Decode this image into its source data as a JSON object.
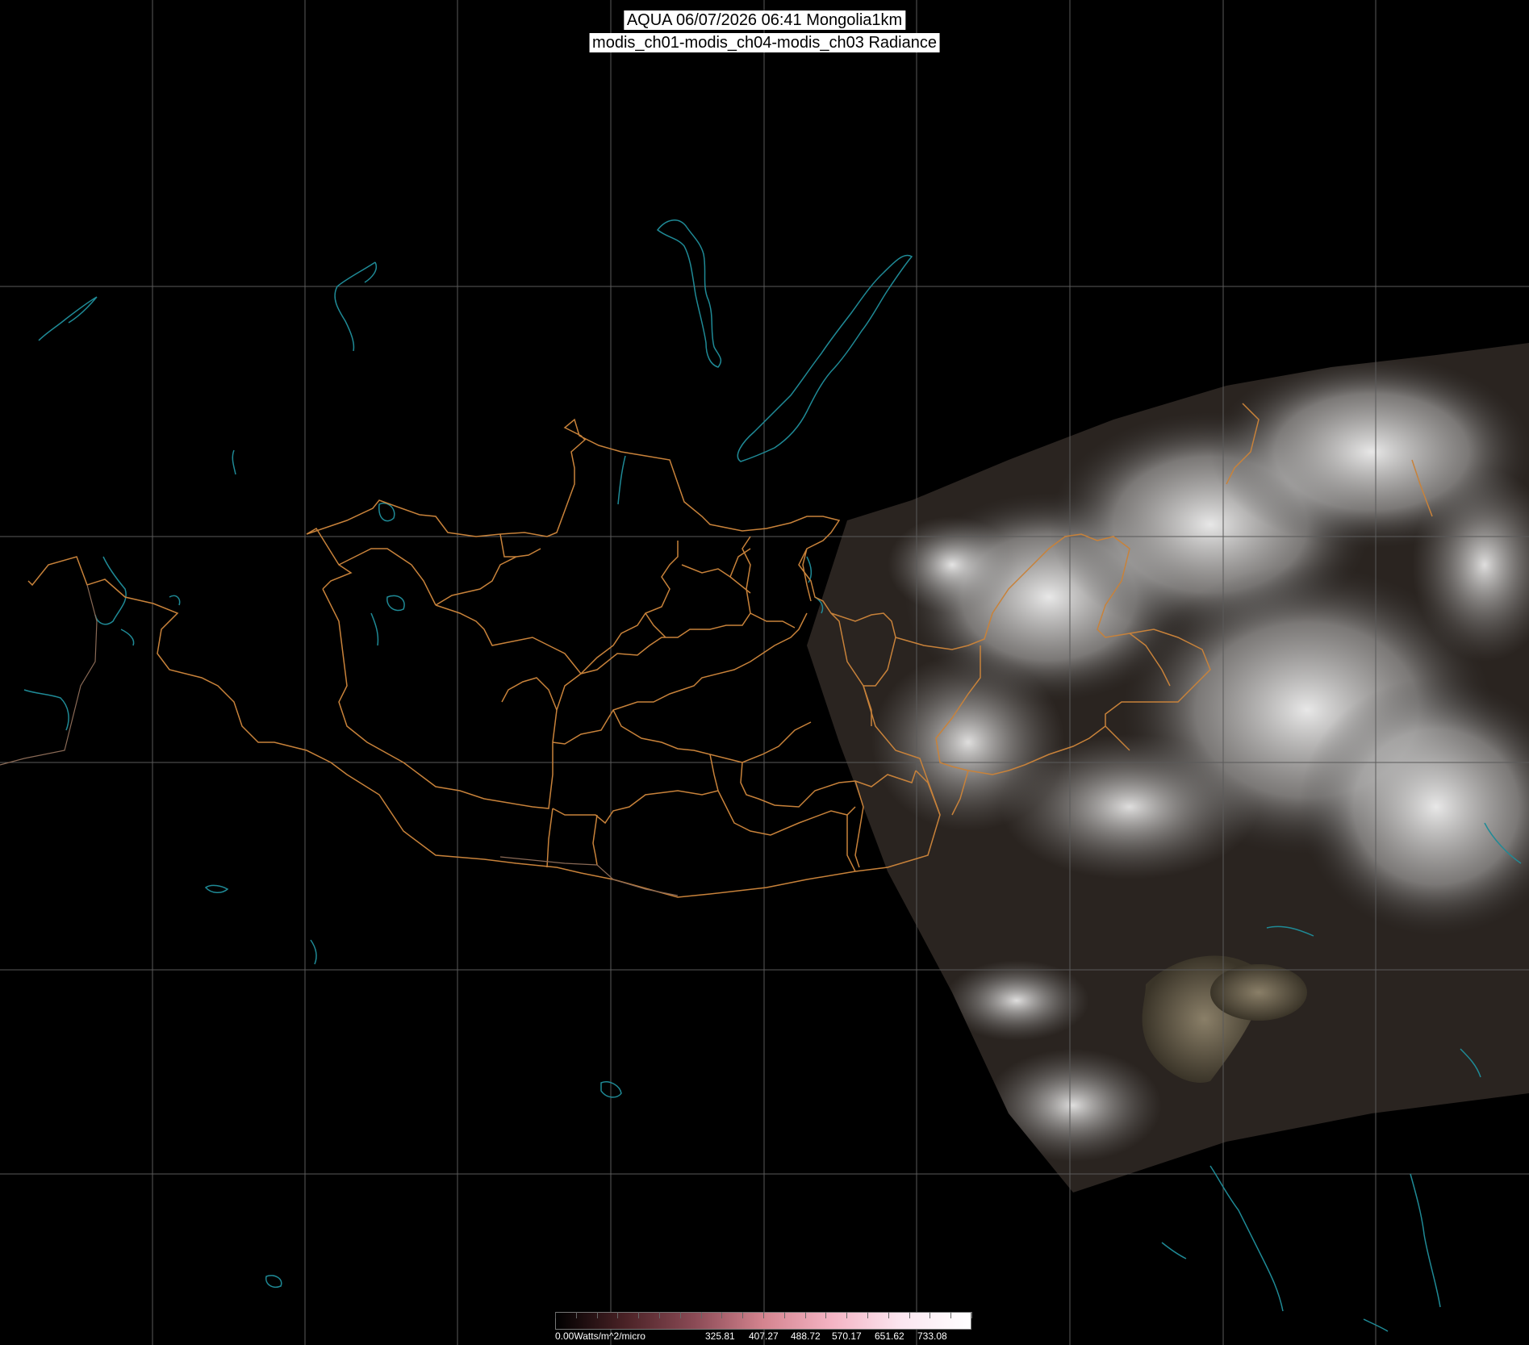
{
  "header": {
    "line1": "AQUA 06/07/2026 06:41 Mongolia1km",
    "line2": "modis_ch01-modis_ch04-modis_ch03 Radiance"
  },
  "colorbar": {
    "unit_label": "0.00Watts/m^2/micro",
    "tick_labels": [
      "325.81",
      "407.27",
      "488.72",
      "570.17",
      "651.62",
      "733.08"
    ],
    "gradient_colors": [
      "#000000",
      "#4a2226",
      "#8a4a55",
      "#d4848f",
      "#f4b4c4",
      "#fbe6f0",
      "#ffffff"
    ]
  },
  "map": {
    "background": "#000000",
    "graticule_color": "#5a5a5a",
    "border_color": "#c8823a",
    "coast_color": "#1f8a96"
  }
}
